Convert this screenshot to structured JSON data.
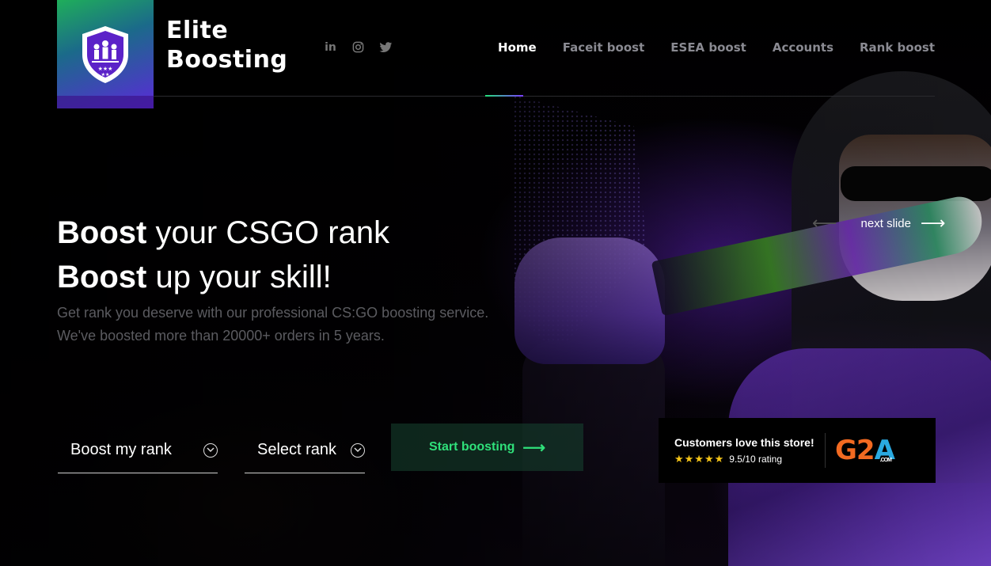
{
  "brand": {
    "line1": "Elite",
    "line2": "Boosting"
  },
  "socials": [
    {
      "name": "linkedin",
      "glyph": "in"
    },
    {
      "name": "instagram",
      "glyph": "◎"
    },
    {
      "name": "twitter",
      "glyph": "🐦"
    }
  ],
  "nav": {
    "items": [
      "Home",
      "Faceit boost",
      "ESEA boost",
      "Accounts",
      "Rank boost"
    ],
    "active": "Home"
  },
  "hero": {
    "line1_bold": "Boost",
    "line1_rest": " your CSGO rank",
    "line2_bold": "Boost",
    "line2_rest": " up your skill!",
    "sub1": "Get rank you deserve with our professional CS:GO boosting service.",
    "sub2": "We've boosted more than 20000+ orders in 5 years."
  },
  "slider": {
    "next_label": "next slide"
  },
  "form": {
    "boost_select": "Boost my rank",
    "rank_select": "Select rank",
    "start_label": "Start boosting"
  },
  "g2a": {
    "title": "Customers love this store!",
    "stars": "★★★★★",
    "rating": "9.5/10 rating",
    "logo_g": "G",
    "logo_2": "2",
    "logo_a": "A",
    "logo_com": ".COM"
  },
  "colors": {
    "accent_green": "#2fe07a",
    "accent_purple": "#7a3cff",
    "nav_inactive": "#8a8a92"
  }
}
